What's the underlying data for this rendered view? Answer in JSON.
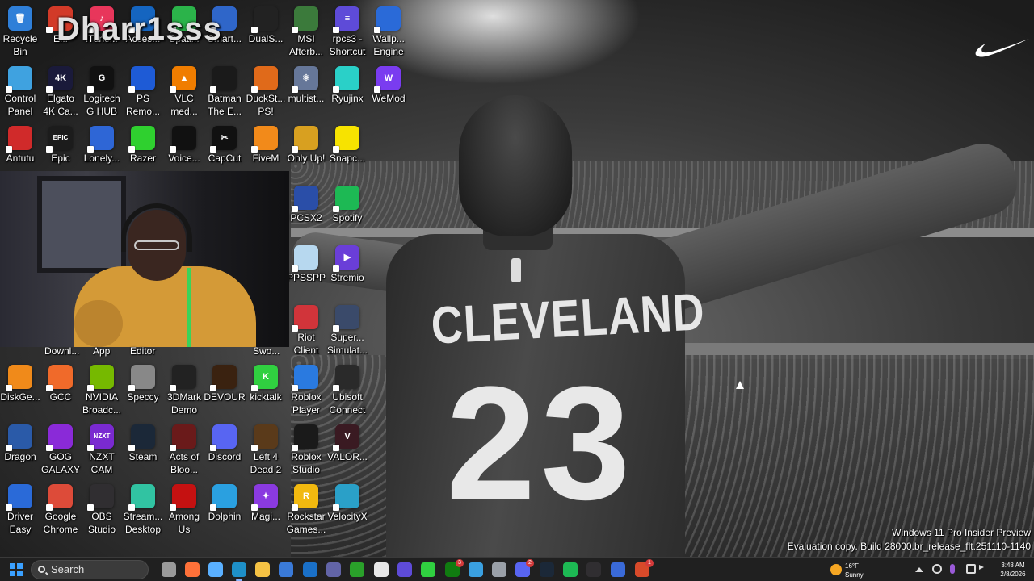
{
  "watermark": "Dharr1sss",
  "desktop_icons": [
    {
      "label": "Recycle\nBin",
      "icon": "recycle-bin-icon",
      "color": "#2f7fd8",
      "glyph": "🗑"
    },
    {
      "label": "E...",
      "icon": "app-icon",
      "color": "#d23a28",
      "glyph": ""
    },
    {
      "label": "iTune...",
      "icon": "itunes-icon",
      "color": "#e8365b",
      "glyph": "♪"
    },
    {
      "label": "Acces...",
      "icon": "app-icon",
      "color": "#1565c0",
      "glyph": ""
    },
    {
      "label": "Spati...",
      "icon": "spatial-icon",
      "color": "#2bb34a",
      "glyph": ""
    },
    {
      "label": "Smart...",
      "icon": "smart-icon",
      "color": "#2f66c9",
      "glyph": ""
    },
    {
      "label": "DualS...",
      "icon": "dualsense-icon",
      "color": "#222222",
      "glyph": ""
    },
    {
      "label": "MSI\nAfterb...",
      "icon": "msi-afterburner-icon",
      "color": "#3b7a3b",
      "glyph": ""
    },
    {
      "label": "rpcs3 -\nShortcut",
      "icon": "rpcs3-icon",
      "color": "#5e4bd8",
      "glyph": "≡"
    },
    {
      "label": "Wallp...\nEngine",
      "icon": "wallpaper-engine-icon",
      "color": "#2a6ad8",
      "glyph": ""
    },
    {
      "label": "Control\nPanel",
      "icon": "control-panel-icon",
      "color": "#3fa2e0",
      "glyph": ""
    },
    {
      "label": "Elgato\n4K Ca...",
      "icon": "elgato-icon",
      "color": "#1a1a3a",
      "glyph": "4K"
    },
    {
      "label": "Logitech\nG HUB",
      "icon": "logitech-icon",
      "color": "#111111",
      "glyph": "G"
    },
    {
      "label": "PS\nRemo...",
      "icon": "ps-remote-play-icon",
      "color": "#1e5bd6",
      "glyph": ""
    },
    {
      "label": "VLC\nmed...",
      "icon": "vlc-icon",
      "color": "#f07d00",
      "glyph": "▲"
    },
    {
      "label": "Batman\nThe E...",
      "icon": "batman-icon",
      "color": "#1a1a1a",
      "glyph": ""
    },
    {
      "label": "DuckSt...\nPS!",
      "icon": "duckstation-icon",
      "color": "#e06a1a",
      "glyph": ""
    },
    {
      "label": "multist...",
      "icon": "multistream-icon",
      "color": "#667799",
      "glyph": "⚛"
    },
    {
      "label": "Ryujinx",
      "icon": "ryujinx-icon",
      "color": "#2ad0c8",
      "glyph": ""
    },
    {
      "label": "WeMod",
      "icon": "wemod-icon",
      "color": "#7a3cf0",
      "glyph": "W"
    },
    {
      "label": "Antutu",
      "icon": "antutu-icon",
      "color": "#d02a2a",
      "glyph": ""
    },
    {
      "label": "Epic",
      "icon": "epic-games-icon",
      "color": "#1c1c1c",
      "glyph": "EPIC"
    },
    {
      "label": "Lonely...",
      "icon": "monitor-icon",
      "color": "#2e66d6",
      "glyph": ""
    },
    {
      "label": "Razer",
      "icon": "razer-icon",
      "color": "#2fd02f",
      "glyph": ""
    },
    {
      "label": "Voice...",
      "icon": "voicemod-icon",
      "color": "#111111",
      "glyph": ""
    },
    {
      "label": "CapCut",
      "icon": "capcut-icon",
      "color": "#111111",
      "glyph": "✂"
    },
    {
      "label": "FiveM",
      "icon": "fivem-icon",
      "color": "#f28a1a",
      "glyph": ""
    },
    {
      "label": "Only Up!",
      "icon": "only-up-icon",
      "color": "#d8a020",
      "glyph": ""
    },
    {
      "label": "Snapc...",
      "icon": "snapchat-icon",
      "color": "#f7e300",
      "glyph": ""
    },
    {
      "label": "PCSX2",
      "icon": "pcsx2-icon",
      "color": "#2a4ea8",
      "glyph": ""
    },
    {
      "label": "Spotify",
      "icon": "spotify-icon",
      "color": "#1db954",
      "glyph": ""
    },
    {
      "label": "PPSSPP",
      "icon": "ppsspp-icon",
      "color": "#b7d8ef",
      "glyph": ""
    },
    {
      "label": "Stremio",
      "icon": "stremio-icon",
      "color": "#6a3ed8",
      "glyph": "▶"
    },
    {
      "label": "Riot\nClient",
      "icon": "riot-client-icon",
      "color": "#d1343a",
      "glyph": ""
    },
    {
      "label": "Super...\nSimulat...",
      "icon": "simulator-icon",
      "color": "#3a4a6a",
      "glyph": ""
    },
    {
      "label": "DiskGe...",
      "icon": "diskgenius-icon",
      "color": "#f08a1a",
      "glyph": ""
    },
    {
      "label": "GCC",
      "icon": "gcc-icon",
      "color": "#f06a2a",
      "glyph": ""
    },
    {
      "label": "NVIDIA\nBroadc...",
      "icon": "nvidia-broadcast-icon",
      "color": "#76b900",
      "glyph": ""
    },
    {
      "label": "Speccy",
      "icon": "speccy-icon",
      "color": "#888888",
      "glyph": ""
    },
    {
      "label": "3DMark\nDemo",
      "icon": "3dmark-icon",
      "color": "#222222",
      "glyph": ""
    },
    {
      "label": "DEVOUR",
      "icon": "devour-icon",
      "color": "#3a2210",
      "glyph": ""
    },
    {
      "label": "kicktalk",
      "icon": "kicktalk-icon",
      "color": "#30d040",
      "glyph": "K"
    },
    {
      "label": "Roblox\nPlayer",
      "icon": "roblox-player-icon",
      "color": "#2a7ae0",
      "glyph": ""
    },
    {
      "label": "Ubisoft\nConnect",
      "icon": "ubisoft-icon",
      "color": "#2a2a2a",
      "glyph": ""
    },
    {
      "label": "Dragon",
      "icon": "dragon-icon",
      "color": "#2a5aa8",
      "glyph": ""
    },
    {
      "label": "GOG\nGALAXY",
      "icon": "gog-galaxy-icon",
      "color": "#8a2ad8",
      "glyph": ""
    },
    {
      "label": "NZXT\nCAM",
      "icon": "nzxt-cam-icon",
      "color": "#7a2ad0",
      "glyph": "NZXT"
    },
    {
      "label": "Steam",
      "icon": "steam-icon",
      "color": "#1b2838",
      "glyph": ""
    },
    {
      "label": "Acts of\nBloo...",
      "icon": "acts-of-blood-icon",
      "color": "#6a1a1a",
      "glyph": ""
    },
    {
      "label": "Discord",
      "icon": "discord-icon",
      "color": "#5865f2",
      "glyph": ""
    },
    {
      "label": "Left 4\nDead 2",
      "icon": "left4dead2-icon",
      "color": "#5a3a1a",
      "glyph": ""
    },
    {
      "label": "Roblox\nStudio",
      "icon": "roblox-studio-icon",
      "color": "#1a1a1a",
      "glyph": ""
    },
    {
      "label": "VALOR...",
      "icon": "valorant-icon",
      "color": "#3a1a22",
      "glyph": "V"
    },
    {
      "label": "Driver\nEasy",
      "icon": "driver-easy-icon",
      "color": "#2a6ad8",
      "glyph": ""
    },
    {
      "label": "Google\nChrome",
      "icon": "chrome-icon",
      "color": "#dd4b39",
      "glyph": ""
    },
    {
      "label": "OBS\nStudio",
      "icon": "obs-icon",
      "color": "#302e31",
      "glyph": ""
    },
    {
      "label": "Stream...\nDesktop",
      "icon": "streamlabs-icon",
      "color": "#31c3a2",
      "glyph": ""
    },
    {
      "label": "Among\nUs",
      "icon": "among-us-icon",
      "color": "#c51111",
      "glyph": ""
    },
    {
      "label": "Dolphin",
      "icon": "dolphin-icon",
      "color": "#2aa0e0",
      "glyph": ""
    },
    {
      "label": "Magi...",
      "icon": "magic-icon",
      "color": "#8a3ae0",
      "glyph": "✦"
    },
    {
      "label": "Rockstar\nGames...",
      "icon": "rockstar-icon",
      "color": "#f2b90f",
      "glyph": "R"
    },
    {
      "label": "VelocityX",
      "icon": "velocityx-icon",
      "color": "#2aa0c8",
      "glyph": ""
    }
  ],
  "obscured_labels": {
    "a": "Downl...",
    "b": "App",
    "c": "Editor",
    "d": "Swo..."
  },
  "wallpaper": {
    "jersey_text": "CLEVELAND",
    "jersey_number": "23"
  },
  "evaluation": {
    "line1": "Windows 11 Pro Insider Preview",
    "line2": "Evaluation copy. Build 28000.br_release_flt.251110-1140"
  },
  "taskbar": {
    "search_label": "Search",
    "weather_temp": "16°F",
    "weather_cond": "Sunny",
    "time": "3:48 AM",
    "date": "2/8/2026",
    "apps": [
      {
        "name": "task-view-icon",
        "color": "#9a9a9a"
      },
      {
        "name": "firefox-icon",
        "color": "#ff7139"
      },
      {
        "name": "copilot-icon",
        "color": "#5ab0ff"
      },
      {
        "name": "edge-icon",
        "color": "#1e90c8",
        "active": true
      },
      {
        "name": "file-explorer-icon",
        "color": "#f5c244"
      },
      {
        "name": "store-icon",
        "color": "#3a7ad8"
      },
      {
        "name": "outlook-icon",
        "color": "#1a70c8"
      },
      {
        "name": "teams-icon",
        "color": "#6264a7"
      },
      {
        "name": "xbox-app-icon",
        "color": "#2aa02a"
      },
      {
        "name": "notepad-icon",
        "color": "#e8e8e8"
      },
      {
        "name": "rpcs3-icon",
        "color": "#5e4bd8"
      },
      {
        "name": "kick-icon",
        "color": "#30d040"
      },
      {
        "name": "xbox-icon",
        "color": "#107c10",
        "badge": "3"
      },
      {
        "name": "photos-icon",
        "color": "#3aa0e0"
      },
      {
        "name": "settings-icon",
        "color": "#9aa0a8"
      },
      {
        "name": "discord-icon",
        "color": "#5865f2",
        "badge": "2"
      },
      {
        "name": "steam-icon",
        "color": "#1b2838"
      },
      {
        "name": "spotify-icon",
        "color": "#1db954"
      },
      {
        "name": "obs-icon",
        "color": "#302e31"
      },
      {
        "name": "app-icon",
        "color": "#3a6ad8"
      },
      {
        "name": "app-badge-icon",
        "color": "#d84a2a",
        "badge": "1"
      }
    ]
  }
}
